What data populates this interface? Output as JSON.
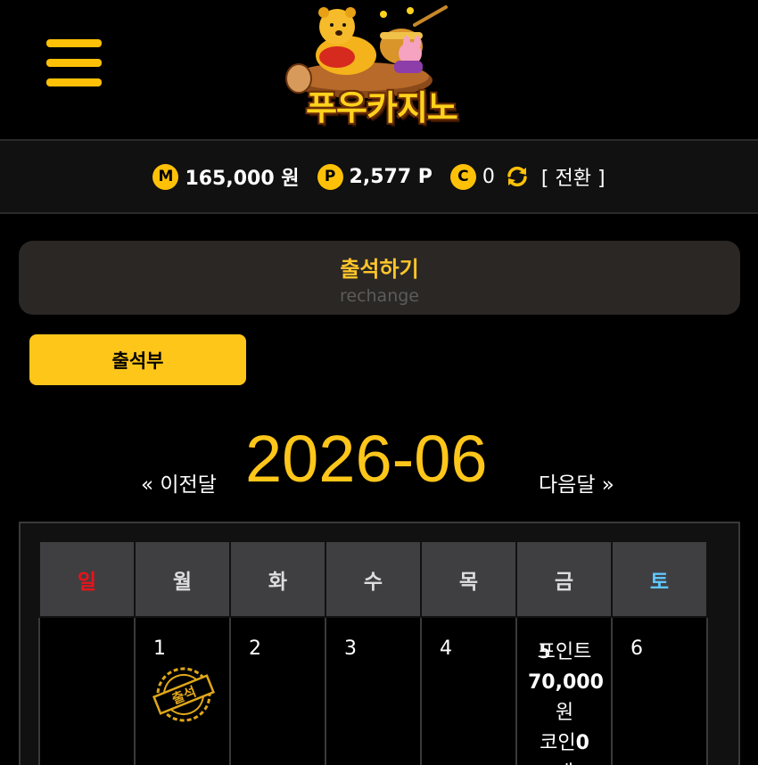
{
  "header": {
    "logo_text": "푸우카지노",
    "menu_icon": "hamburger-icon"
  },
  "balance": {
    "money_badge": "M",
    "money": "165,000 원",
    "point_badge": "P",
    "points": "2,577 P",
    "coin_badge": "C",
    "coins": "0",
    "refresh_icon": "refresh-icon",
    "convert_label": "[ 전환 ]"
  },
  "page": {
    "title": "출석하기",
    "subtitle": "rechange",
    "book_button": "출석부"
  },
  "calendar": {
    "prev_label": "« 이전달",
    "month": "2026-06",
    "next_label": "다음달 »",
    "weekdays": [
      "일",
      "월",
      "화",
      "수",
      "목",
      "금",
      "토"
    ],
    "colors": {
      "sunday": "#e8141a",
      "saturday": "#5fc6ff",
      "accent": "#ffc61a"
    },
    "days": [
      "",
      "1",
      "2",
      "3",
      "4",
      "5",
      "6"
    ],
    "stamp_text": "출석",
    "reward": {
      "line1": "포인트",
      "amount": "70,000",
      "unit": "원",
      "coin_prefix": "코인",
      "coin_count": "0",
      "coin_suffix": " 개"
    }
  }
}
